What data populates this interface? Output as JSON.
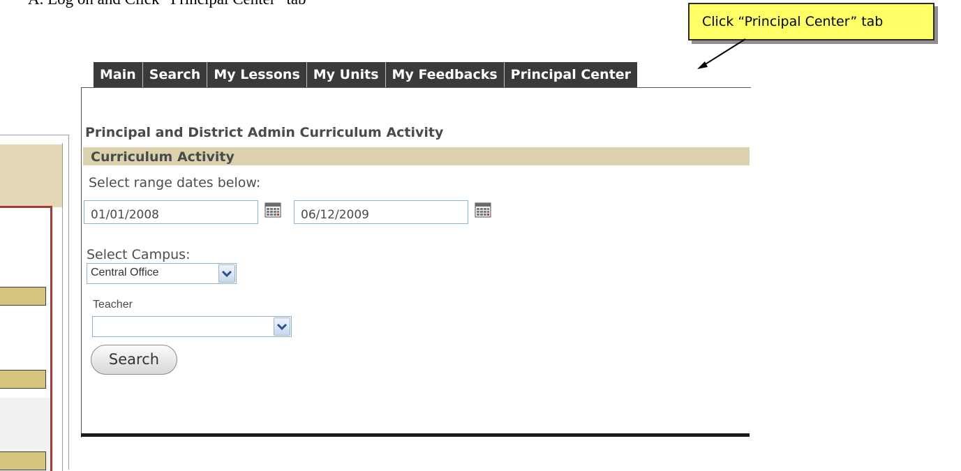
{
  "instruction": {
    "text": "A. Log on and Click “Principal Center” tab"
  },
  "callout": {
    "text": "Click “Principal Center” tab"
  },
  "tabs": [
    "Main",
    "Search",
    "My Lessons",
    "My Units",
    "My Feedbacks",
    "Principal Center"
  ],
  "page": {
    "title": "Principal and District Admin Curriculum Activity",
    "section_title": "Curriculum Activity",
    "range_label": "Select range dates below:",
    "start_date": "01/01/2008",
    "end_date": "06/12/2009",
    "campus_label": "Select Campus:",
    "campus_value": "Central Office",
    "teacher_label": "Teacher",
    "teacher_value": "",
    "search_button": "Search"
  },
  "icons": {
    "calendar": "calendar-icon",
    "dropdown": "chevron-down-icon",
    "callout_arrow": "arrow-icon"
  },
  "colors": {
    "tab_bar": "#3a3a3a",
    "section_bar": "#dcd1ad",
    "callout_bg": "#ffff66",
    "input_border": "#8fb3d0",
    "left_bar": "#d6c67d",
    "left_red": "#a33b3b"
  }
}
